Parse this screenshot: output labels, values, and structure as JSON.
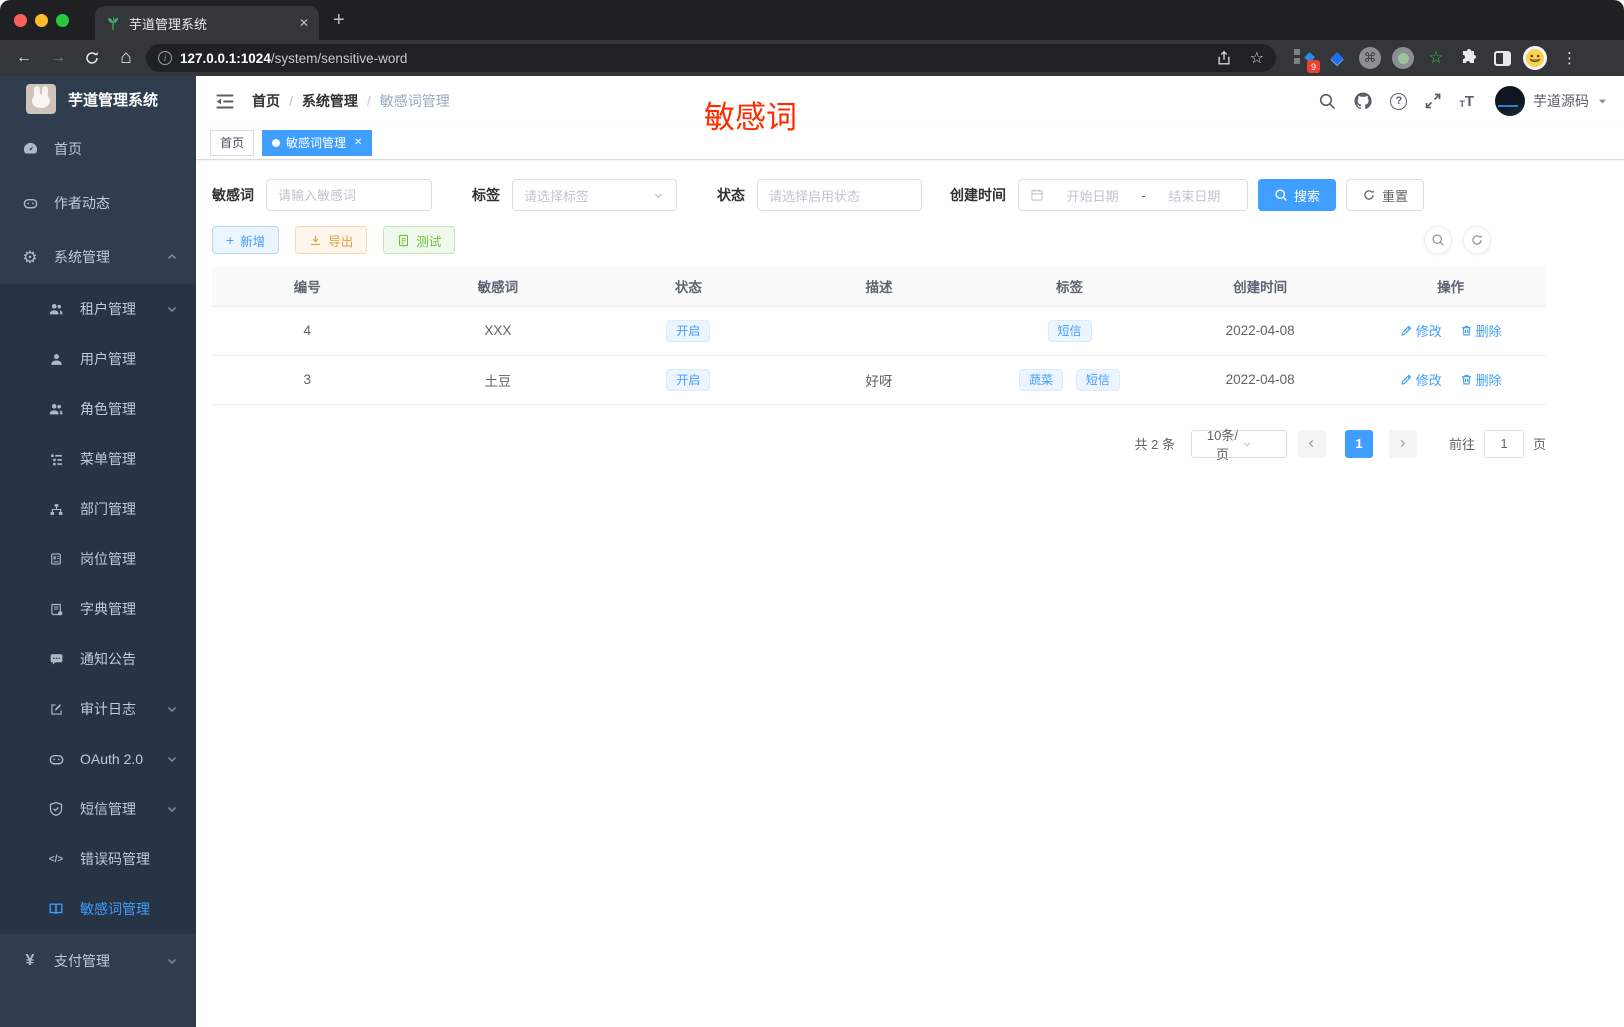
{
  "colors": {
    "accent": "#409eff",
    "warning": "#e6a23c",
    "success": "#67c23a",
    "annotation_red": "#fe2b00",
    "sidebar_bg": "#2f3d4f",
    "submenu_bg": "#263445"
  },
  "icons": {
    "gear": "⚙",
    "yen": "¥",
    "code": "</>",
    "plus": "+",
    "dots_vertical": "⋮",
    "command": "⌘",
    "star_outline": "☆",
    "diamond": "◆",
    "gem": "◆",
    "back_arrow": "←",
    "forward_arrow": "→",
    "home": "⌂",
    "info": "i",
    "question": "?",
    "close": "✕",
    "big_t": "T",
    "small_t": "T",
    "ext_badge": "9",
    "tab_dot": "",
    "date_dash": "-"
  },
  "browser": {
    "tab_title": "芋道管理系统",
    "url_host": "127.0.0.1:1024",
    "url_path": "/system/sensitive-word"
  },
  "sidebar": {
    "logo_title": "芋道管理系统",
    "items": [
      {
        "label": "首页"
      },
      {
        "label": "作者动态"
      },
      {
        "label": "系统管理"
      },
      {
        "label": "租户管理"
      },
      {
        "label": "用户管理"
      },
      {
        "label": "角色管理"
      },
      {
        "label": "菜单管理"
      },
      {
        "label": "部门管理"
      },
      {
        "label": "岗位管理"
      },
      {
        "label": "字典管理"
      },
      {
        "label": "通知公告"
      },
      {
        "label": "审计日志"
      },
      {
        "label": "OAuth 2.0"
      },
      {
        "label": "短信管理"
      },
      {
        "label": "错误码管理"
      },
      {
        "label": "敏感词管理"
      },
      {
        "label": "支付管理"
      }
    ]
  },
  "header": {
    "breadcrumb": [
      "首页",
      "系统管理",
      "敏感词管理"
    ],
    "separator": "/",
    "user_name": "芋道源码",
    "annotation": "敏感词"
  },
  "tabs_view": {
    "items": [
      {
        "label": "首页"
      },
      {
        "label": "敏感词管理"
      }
    ]
  },
  "filters": {
    "keyword_label": "敏感词",
    "keyword_placeholder": "请输入敏感词",
    "tag_label": "标签",
    "tag_placeholder": "请选择标签",
    "status_label": "状态",
    "status_placeholder": "请选择启用状态",
    "date_label": "创建时间",
    "date_start_placeholder": "开始日期",
    "date_separator": "-",
    "date_end_placeholder": "结束日期",
    "search_label": "搜索",
    "reset_label": "重置"
  },
  "toolbar": {
    "add_label": "新增",
    "export_label": "导出",
    "test_label": "测试"
  },
  "table": {
    "headers": [
      "编号",
      "敏感词",
      "状态",
      "描述",
      "标签",
      "创建时间",
      "操作"
    ],
    "rows": [
      {
        "id": "4",
        "word": "XXX",
        "status": "开启",
        "description": "",
        "tags": [
          "短信"
        ],
        "created": "2022-04-08",
        "edit": "修改",
        "delete": "删除"
      },
      {
        "id": "3",
        "word": "土豆",
        "status": "开启",
        "description": "好呀",
        "tags": [
          "蔬菜",
          "短信"
        ],
        "created": "2022-04-08",
        "edit": "修改",
        "delete": "删除"
      }
    ]
  },
  "pagination": {
    "total_text": "共 2 条",
    "page_size": "10条/页",
    "current_page": "1",
    "goto_label": "前往",
    "goto_value": "1",
    "page_label": "页"
  }
}
